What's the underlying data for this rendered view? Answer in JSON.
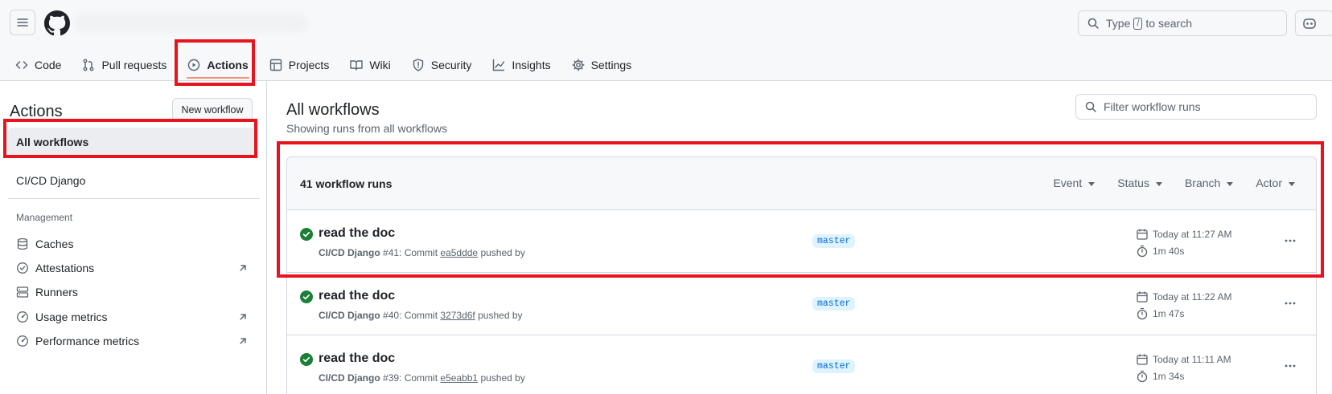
{
  "header": {
    "search_prefix": "Type",
    "search_key": "/",
    "search_suffix": "to search"
  },
  "repo_nav": {
    "items": [
      {
        "label": "Code",
        "icon": "code-icon"
      },
      {
        "label": "Pull requests",
        "icon": "pull-request-icon"
      },
      {
        "label": "Actions",
        "icon": "play-icon",
        "active": true
      },
      {
        "label": "Projects",
        "icon": "table-icon"
      },
      {
        "label": "Wiki",
        "icon": "book-icon"
      },
      {
        "label": "Security",
        "icon": "shield-icon"
      },
      {
        "label": "Insights",
        "icon": "graph-icon"
      },
      {
        "label": "Settings",
        "icon": "gear-icon"
      }
    ]
  },
  "sidebar": {
    "title": "Actions",
    "new_workflow_label": "New workflow",
    "workflows": [
      {
        "label": "All workflows",
        "selected": true
      },
      {
        "label": "CI/CD Django"
      }
    ],
    "management_heading": "Management",
    "management": [
      {
        "label": "Caches",
        "icon": "database-icon"
      },
      {
        "label": "Attestations",
        "icon": "verified-icon",
        "external": true
      },
      {
        "label": "Runners",
        "icon": "server-icon"
      },
      {
        "label": "Usage metrics",
        "icon": "meter-icon",
        "external": true
      },
      {
        "label": "Performance metrics",
        "icon": "meter-icon",
        "external": true
      }
    ]
  },
  "main": {
    "title": "All workflows",
    "subtitle": "Showing runs from all workflows",
    "filter_placeholder": "Filter workflow runs",
    "runs_count": "41 workflow runs",
    "filters": [
      "Event",
      "Status",
      "Branch",
      "Actor"
    ],
    "runs": [
      {
        "title": "read the doc",
        "workflow": "CI/CD Django",
        "number": "#41",
        "commit_prefix": ": Commit",
        "sha": "ea5ddde",
        "pushed": "pushed by",
        "branch": "master",
        "date": "Today at 11:27 AM",
        "duration": "1m 40s"
      },
      {
        "title": "read the doc",
        "workflow": "CI/CD Django",
        "number": "#40",
        "commit_prefix": ": Commit",
        "sha": "3273d6f",
        "pushed": "pushed by",
        "branch": "master",
        "date": "Today at 11:22 AM",
        "duration": "1m 47s"
      },
      {
        "title": "read the doc",
        "workflow": "CI/CD Django",
        "number": "#39",
        "commit_prefix": ": Commit",
        "sha": "e5eabb1",
        "pushed": "pushed by",
        "branch": "master",
        "date": "Today at 11:11 AM",
        "duration": "1m 34s"
      }
    ]
  },
  "colors": {
    "annotation": "#e8131d",
    "success": "#1a7f37",
    "link": "#0969da",
    "active_underline": "#fd8c73"
  }
}
